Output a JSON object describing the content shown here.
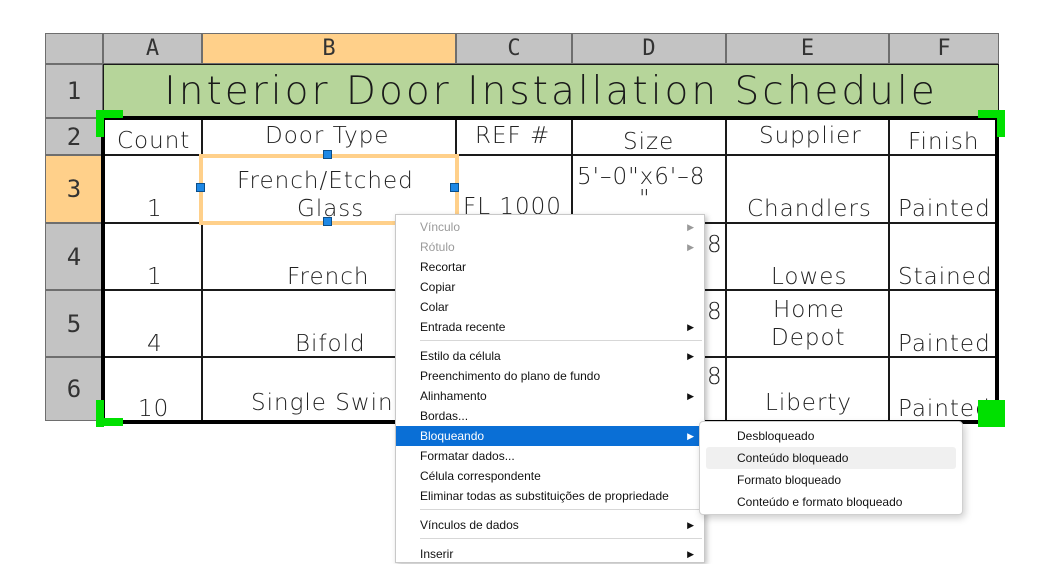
{
  "columns": [
    "A",
    "B",
    "C",
    "D",
    "E",
    "F"
  ],
  "rows": [
    "1",
    "2",
    "3",
    "4",
    "5",
    "6"
  ],
  "title": "Interior Door Installation Schedule",
  "headers": [
    "Count",
    "Door Type",
    "REF #",
    "Size",
    "Supplier",
    "Finish"
  ],
  "data": [
    [
      "1",
      "French/Etched",
      "Glass",
      "FL 1000",
      "5'–0\"x6'–8",
      "\"",
      "Chandlers",
      "Painted"
    ],
    [
      "1",
      "French",
      "8",
      "Lowes",
      "Stained"
    ],
    [
      "4",
      "Bifold",
      "8",
      "Home",
      "Depot",
      "Painted"
    ],
    [
      "10",
      "Single Swin",
      "8",
      "Liberty",
      "Painted"
    ]
  ],
  "menu": {
    "items": [
      "Vínculo",
      "Rótulo",
      "Recortar",
      "Copiar",
      "Colar",
      "Entrada recente",
      "Estilo da célula",
      "Preenchimento do plano de fundo",
      "Alinhamento",
      "Bordas...",
      "Bloqueando",
      "Formatar dados...",
      "Célula correspondente",
      "Eliminar todas as substituições de propriedade",
      "Vínculos de dados",
      "Inserir"
    ]
  },
  "submenu": {
    "items": [
      "Desbloqueado",
      "Conteúdo bloqueado",
      "Formato bloqueado",
      "Conteúdo e formato bloqueado"
    ]
  },
  "colors": {
    "title_bg": "#b6d59a",
    "header_selected": "#ffd08a",
    "grip_green": "#00e000",
    "menu_highlight": "#0a6fd6"
  }
}
